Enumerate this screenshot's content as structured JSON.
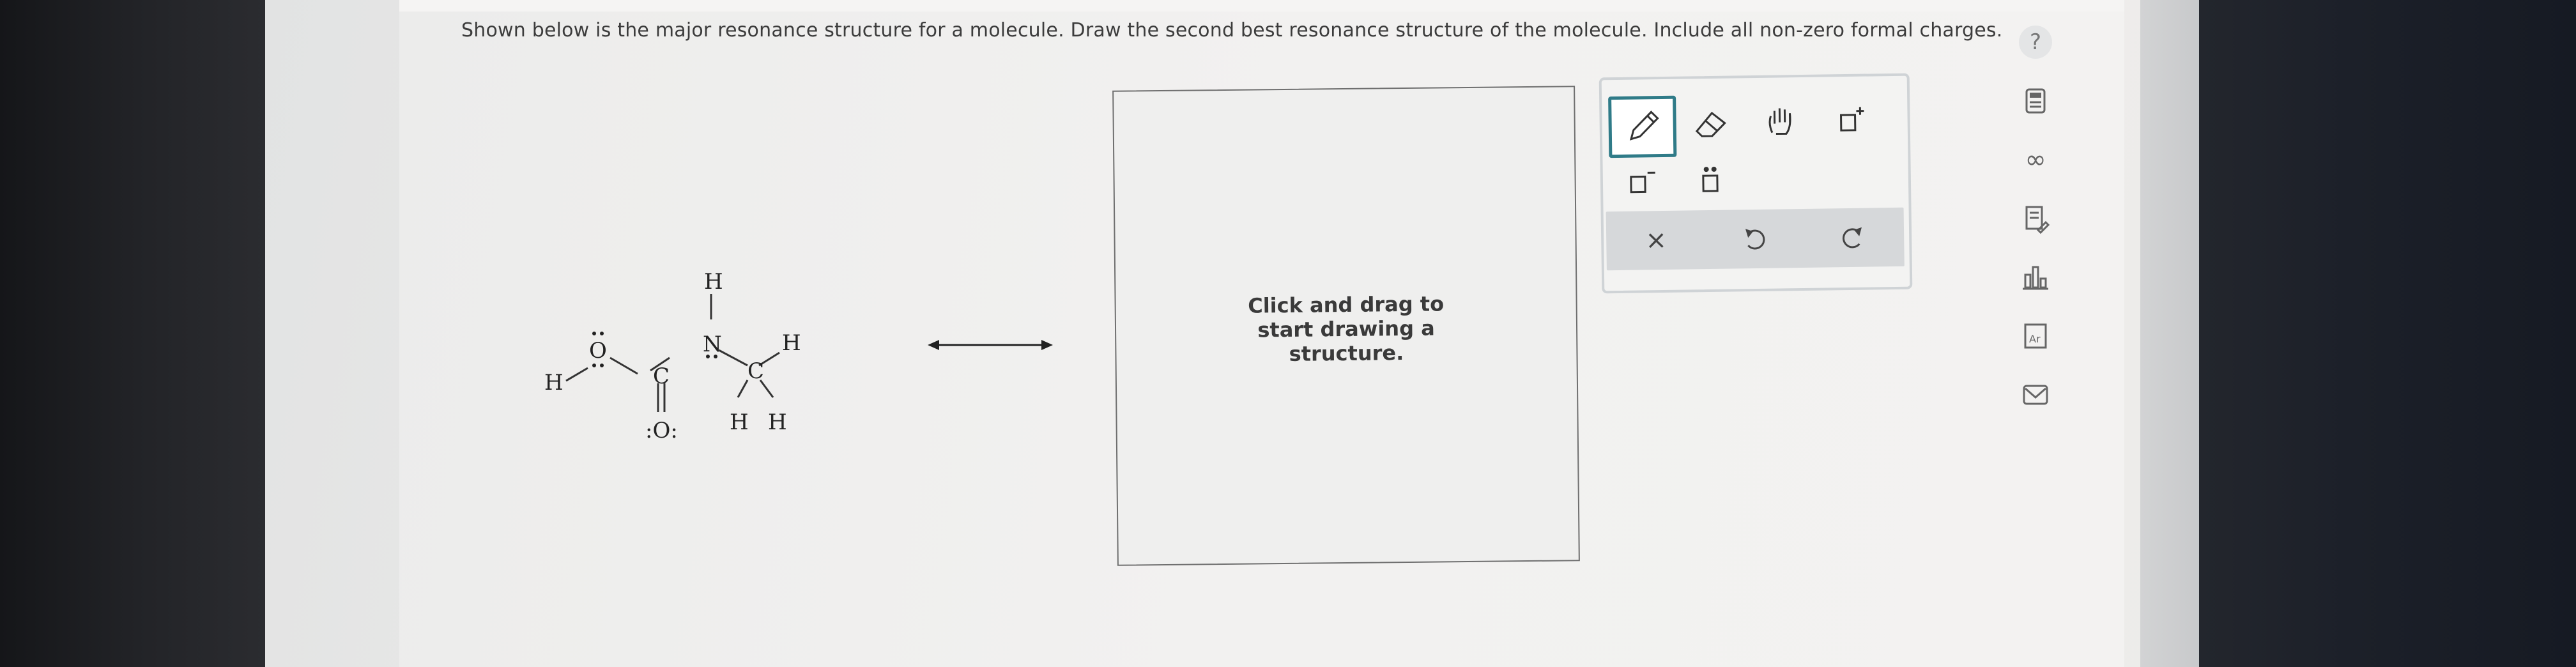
{
  "question": {
    "text": "Shown below is the major resonance structure for a molecule. Draw the second best resonance structure of the molecule. Include all non-zero formal charges."
  },
  "molecule": {
    "atoms": {
      "h_left": "H",
      "o_single": "O",
      "c_carbonyl": "C",
      "o_double": ":O:",
      "n": "N",
      "h_on_n": "H",
      "c_methyl": "C",
      "h_right": "H",
      "h_bottom_left": "H",
      "h_bottom_right": "H"
    }
  },
  "canvas": {
    "hint": "Click and drag to start drawing a structure."
  },
  "toolbar": {
    "tools": [
      "pencil-icon",
      "eraser-icon",
      "hand-icon",
      "positive-charge-icon",
      "negative-charge-icon",
      "lone-pair-icon"
    ],
    "actions": [
      "clear-icon",
      "undo-icon",
      "redo-icon"
    ],
    "clear_label": "×"
  },
  "side_tools": {
    "help_label": "?",
    "items": [
      "calculator-icon",
      "infinity-icon",
      "notes-icon",
      "bar-chart-icon",
      "periodic-table-icon",
      "mail-icon"
    ],
    "periodic_label": "Ar",
    "infinity_label": "∞"
  },
  "colors": {
    "accent": "#2f7b88",
    "screen_bg": "#f1f0ef",
    "text": "#3c3c3c"
  }
}
